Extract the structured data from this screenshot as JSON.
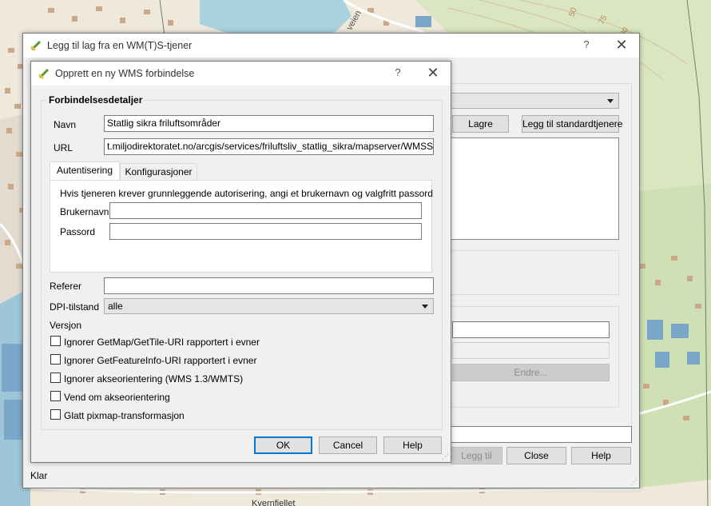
{
  "background_window": {
    "title": "Legg til lag fra en WM(T)S-tjener",
    "help_label": "?",
    "buttons": {
      "save": "Lagre",
      "add_default": "Legg til standardtjenere",
      "change": "Endre...",
      "add_layer": "Legg til",
      "close": "Close",
      "help": "Help"
    },
    "status": "Klar"
  },
  "dialog": {
    "title": "Opprett en ny WMS forbindelse",
    "help_label": "?",
    "connection_group": "Forbindelsesdetaljer",
    "name_label": "Navn",
    "name_value": "Statlig sikra friluftsområder",
    "url_label": "URL",
    "url_value": "t.miljodirektoratet.no/arcgis/services/friluftsliv_statlig_sikra/mapserver/WMSServer?",
    "tabs": [
      {
        "label": "Autentisering",
        "active": true
      },
      {
        "label": "Konfigurasjoner",
        "active": false
      }
    ],
    "auth_info": "Hvis tjeneren krever grunnleggende autorisering, angi et brukernavn og valgfritt passord",
    "username_label": "Brukernavn",
    "username_value": "",
    "password_label": "Passord",
    "password_value": "",
    "referer_label": "Referer",
    "referer_value": "",
    "dpi_label": "DPI-tilstand",
    "dpi_value": "alle",
    "version_label": "Versjon",
    "checkboxes": [
      {
        "label": "Ignorer GetMap/GetTile-URI rapportert i evner",
        "checked": false
      },
      {
        "label": "Ignorer GetFeatureInfo-URI rapportert i evner",
        "checked": false
      },
      {
        "label": "Ignorer akseorientering (WMS 1.3/WMTS)",
        "checked": false
      },
      {
        "label": "Vend om akseorientering",
        "checked": false
      },
      {
        "label": "Glatt pixmap-transformasjon",
        "checked": false
      }
    ],
    "buttons": {
      "ok": "OK",
      "cancel": "Cancel",
      "help": "Help"
    }
  },
  "map": {
    "contour_labels": [
      "50",
      "75",
      "100"
    ],
    "street_labels": [
      "veien",
      "Kvernfjellet"
    ],
    "colors": {
      "land": "#efe9dc",
      "water": "#aad3df",
      "forest": "#cfe0b4",
      "building": "#c9a98a",
      "residential": "#e0dbd2"
    }
  }
}
